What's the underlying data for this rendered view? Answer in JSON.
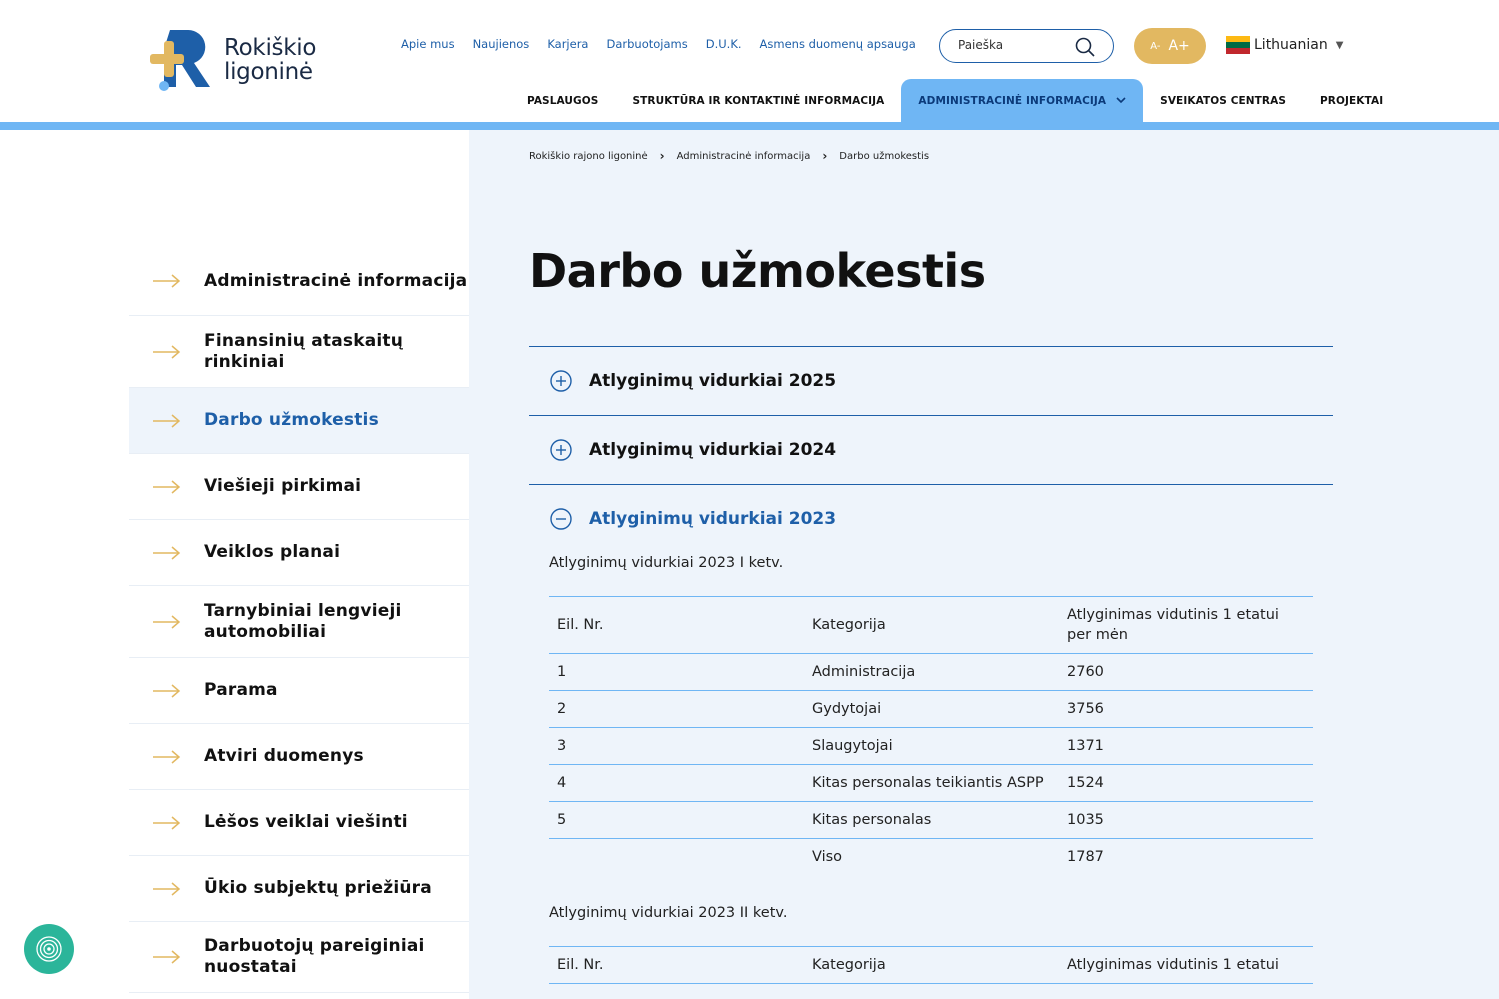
{
  "logo": {
    "line1": "Rokiškio",
    "line2": "ligoninė"
  },
  "top_links": [
    "Apie mus",
    "Naujienos",
    "Karjera",
    "Darbuotojams",
    "D.U.K.",
    "Asmens duomenų apsauga"
  ],
  "search": {
    "placeholder": "Paieška"
  },
  "font_size": {
    "decrease": "A-",
    "increase": "A+"
  },
  "language": {
    "label": "Lithuanian"
  },
  "main_nav": [
    {
      "label": "PASLAUGOS"
    },
    {
      "label": "STRUKTŪRA IR KONTAKTINĖ INFORMACIJA"
    },
    {
      "label": "ADMINISTRACINĖ INFORMACIJA"
    },
    {
      "label": "SVEIKATOS CENTRAS"
    },
    {
      "label": "PROJEKTAI"
    }
  ],
  "breadcrumb": [
    "Rokiškio rajono ligoninė",
    "Administracinė informacija",
    "Darbo užmokestis"
  ],
  "page_title": "Darbo užmokestis",
  "sidebar": [
    {
      "label": "Administracinė informacija"
    },
    {
      "label": "Finansinių ataskaitų rinkiniai"
    },
    {
      "label": "Darbo užmokestis"
    },
    {
      "label": "Viešieji pirkimai"
    },
    {
      "label": "Veiklos planai"
    },
    {
      "label": "Tarnybiniai lengvieji automobiliai"
    },
    {
      "label": "Parama"
    },
    {
      "label": "Atviri duomenys"
    },
    {
      "label": "Lėšos veiklai viešinti"
    },
    {
      "label": "Ūkio subjektų priežiūra"
    },
    {
      "label": "Darbuotojų pareiginiai nuostatai"
    }
  ],
  "accordion": [
    {
      "title": "Atlyginimų vidurkiai 2025"
    },
    {
      "title": "Atlyginimų vidurkiai 2024"
    },
    {
      "title": "Atlyginimų vidurkiai 2023"
    }
  ],
  "section_2023": {
    "q1_heading": "Atlyginimų vidurkiai 2023 I ketv.",
    "headers": [
      "Eil. Nr.",
      "Kategorija",
      "Atlyginimas vidutinis 1 etatui per mėn"
    ],
    "rows": [
      [
        "1",
        "Administracija",
        "2760"
      ],
      [
        "2",
        "Gydytojai",
        "3756"
      ],
      [
        "3",
        "Slaugytojai",
        "1371"
      ],
      [
        "4",
        "Kitas personalas teikiantis ASPP",
        "1524"
      ],
      [
        "5",
        "Kitas personalas",
        "1035"
      ],
      [
        "",
        "Viso",
        "1787"
      ]
    ],
    "q2_heading": "Atlyginimų vidurkiai 2023 II ketv.",
    "q2_headers": [
      "Eil. Nr.",
      "Kategorija",
      "Atlyginimas vidutinis 1 etatui"
    ]
  },
  "colors": {
    "brand_blue": "#1e5fa8",
    "accent_light_blue": "#6fb6f4",
    "gold": "#e2b861"
  }
}
